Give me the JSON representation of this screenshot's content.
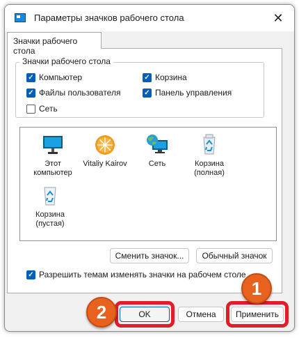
{
  "window": {
    "title": "Параметры значков рабочего стола",
    "close_glyph": "✕"
  },
  "tab": {
    "label": "Значки рабочего стола"
  },
  "group": {
    "title": "Значки рабочего стола",
    "checkboxes": [
      {
        "label": "Компьютер",
        "checked": true
      },
      {
        "label": "Корзина",
        "checked": true
      },
      {
        "label": "Файлы пользователя",
        "checked": true
      },
      {
        "label": "Панель управления",
        "checked": true
      },
      {
        "label": "Сеть",
        "checked": false
      }
    ]
  },
  "icons": [
    {
      "label": "Этот компьютер",
      "icon": "monitor-icon"
    },
    {
      "label": "Vitaliy Kairov",
      "icon": "user-folder-icon"
    },
    {
      "label": "Сеть",
      "icon": "network-icon"
    },
    {
      "label": "Корзина (полная)",
      "icon": "recycle-bin-full-icon"
    },
    {
      "label": "Корзина (пустая)",
      "icon": "recycle-bin-empty-icon"
    }
  ],
  "buttons": {
    "change_icon": "Сменить значок...",
    "default_icon": "Обычный значок",
    "ok": "OK",
    "cancel": "Отмена",
    "apply": "Применить"
  },
  "themes_checkbox": {
    "label": "Разрешить темам изменять значки на рабочем столе",
    "checked": true
  },
  "badges": {
    "apply_step": "1",
    "ok_step": "2"
  },
  "colors": {
    "accent": "#005fb8",
    "highlight": "#e11d2a",
    "badge": "#e8621f"
  }
}
